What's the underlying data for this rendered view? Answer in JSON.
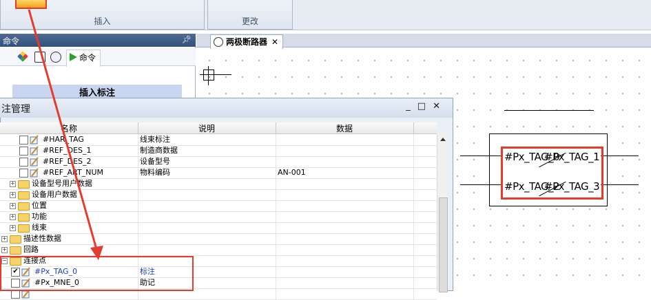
{
  "ribbon": {
    "insert_label": "插入",
    "modify_label": "更改"
  },
  "command_panel": {
    "title": "命令",
    "pin": "ᵩ",
    "active_tab": "命令",
    "insert_tag_label": "插入标注"
  },
  "document": {
    "tab_title": "两极断路器",
    "close": "✕",
    "tags": [
      "#Px_TAG_0",
      "#Px_TAG_1",
      "#Px_TAG_2",
      "#Px_TAG_3"
    ]
  },
  "dialog": {
    "title": "注管理",
    "min": "_",
    "max": "□",
    "close": "✕",
    "columns": [
      "名称",
      "说明",
      "数据"
    ],
    "rows": [
      {
        "type": "tag",
        "indent": 24,
        "checked": false,
        "name": "#HAR_TAG",
        "desc": "线束标注",
        "data": ""
      },
      {
        "type": "tag",
        "indent": 24,
        "checked": false,
        "name": "#REF_DES_1",
        "desc": "制造商数据",
        "data": ""
      },
      {
        "type": "tag",
        "indent": 24,
        "checked": false,
        "name": "#REF_DES_2",
        "desc": "设备型号",
        "data": ""
      },
      {
        "type": "tag",
        "indent": 24,
        "checked": false,
        "name": "#REF_ART_NUM",
        "desc": "物料编码",
        "data": "AN-001"
      },
      {
        "type": "folder",
        "indent": 12,
        "name": "设备型号用户数据"
      },
      {
        "type": "folder",
        "indent": 12,
        "name": "设备用户数据"
      },
      {
        "type": "folder",
        "indent": 12,
        "name": "位置"
      },
      {
        "type": "folder",
        "indent": 12,
        "name": "功能"
      },
      {
        "type": "folder",
        "indent": 12,
        "name": "线束"
      },
      {
        "type": "folder",
        "indent": 0,
        "name": "描述性数据"
      },
      {
        "type": "folder",
        "indent": 0,
        "name": "回路"
      },
      {
        "type": "folder",
        "indent": 0,
        "name": "连接点",
        "open": true
      },
      {
        "type": "tag",
        "indent": 12,
        "checked": true,
        "blue": true,
        "name": "#Px_TAG_0",
        "desc": "标注",
        "data": ""
      },
      {
        "type": "tag",
        "indent": 12,
        "checked": false,
        "name": "#Px_MNE_0",
        "desc": "助记",
        "data": ""
      },
      {
        "type": "tag",
        "indent": 12,
        "checked": false,
        "name": "",
        "desc": "",
        "data": ""
      }
    ]
  },
  "colors": {
    "highlight_red": "#e53b2d",
    "selected_blue": "#1a3ec8",
    "panel_header": "#34507a"
  }
}
